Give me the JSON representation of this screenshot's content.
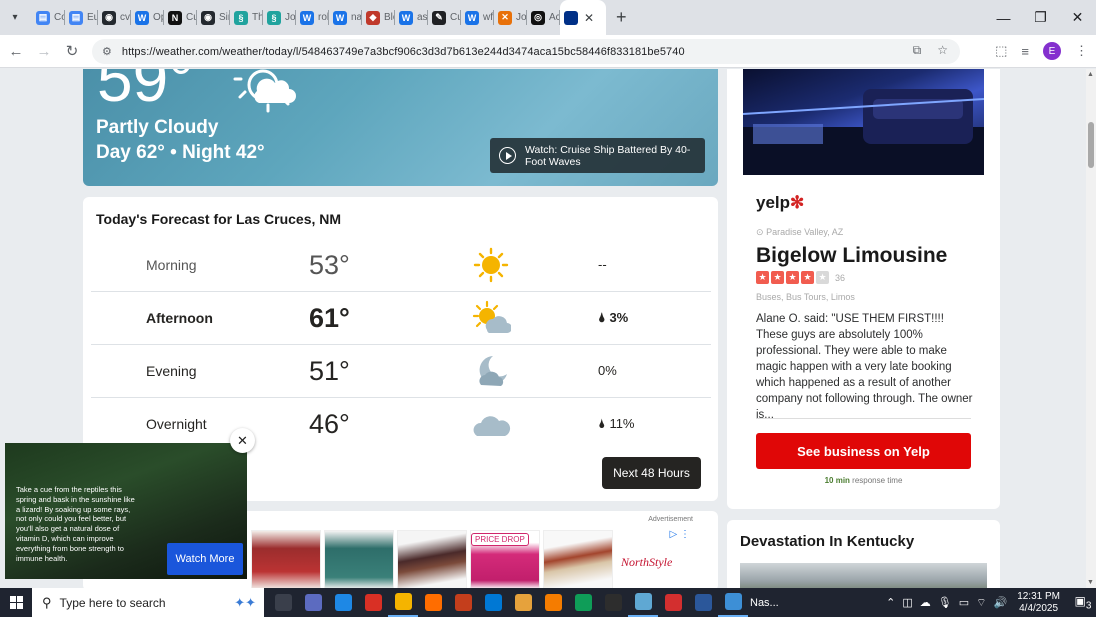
{
  "browser": {
    "tabs": [
      {
        "title": "Cov",
        "color": "#4285f4",
        "glyph": "▤"
      },
      {
        "title": "Eug",
        "color": "#4285f4",
        "glyph": "▤"
      },
      {
        "title": "cvn",
        "color": "#24292f",
        "glyph": "◉"
      },
      {
        "title": "Op",
        "color": "#1a73e8",
        "glyph": "W"
      },
      {
        "title": "Cus",
        "color": "#111111",
        "glyph": "N"
      },
      {
        "title": "Sin",
        "color": "#24292f",
        "glyph": "◉"
      },
      {
        "title": "Tha",
        "color": "#20a39e",
        "glyph": "§"
      },
      {
        "title": "Job",
        "color": "#20a39e",
        "glyph": "§"
      },
      {
        "title": "rob",
        "color": "#1a73e8",
        "glyph": "W"
      },
      {
        "title": "nat",
        "color": "#1a73e8",
        "glyph": "W"
      },
      {
        "title": "Blo",
        "color": "#c0392b",
        "glyph": "◆"
      },
      {
        "title": "ass",
        "color": "#1a73e8",
        "glyph": "W"
      },
      {
        "title": "Cur",
        "color": "#202124",
        "glyph": "✎"
      },
      {
        "title": "wf",
        "color": "#1a73e8",
        "glyph": "W"
      },
      {
        "title": "Job",
        "color": "#e8710a",
        "glyph": "✕"
      },
      {
        "title": "Act",
        "color": "#111111",
        "glyph": "◎"
      }
    ],
    "active_tab": {
      "color": "#003087",
      "close": "✕"
    },
    "new_tab": "+",
    "window_controls": {
      "minimize": "—",
      "maximize": "❐",
      "close": "✕"
    },
    "url": "https://weather.com/weather/today/l/548463749e7a3bcf906c3d3d7b613e244d3474aca15bc58446f833181be5740"
  },
  "hero": {
    "temperature": "59°",
    "phrase": "Partly Cloudy",
    "day_night": "Day 62° • Night 42°",
    "video_title": "Watch: Cruise Ship Battered By 40-Foot Waves"
  },
  "forecast": {
    "title": "Today's Forecast for Las Cruces, NM",
    "rows": [
      {
        "period": "Morning",
        "temp": "53°",
        "icon": "sunny",
        "precip": "--"
      },
      {
        "period": "Afternoon",
        "temp": "61°",
        "icon": "partly-cloudy-day",
        "precip": "3%"
      },
      {
        "period": "Evening",
        "temp": "51°",
        "icon": "mostly-cloudy-night",
        "precip": "0%"
      },
      {
        "period": "Overnight",
        "temp": "46°",
        "icon": "cloudy",
        "precip": "11%"
      }
    ],
    "next_button": "Next 48 Hours"
  },
  "video_ad": {
    "text": "Take a cue from the reptiles this spring and bask in the sunshine like a lizard! By soaking up some rays, not only could you feel better, but you'll also get a natural dose of vitamin D, which can improve everything from bone strength to immune health.",
    "button": "Watch More",
    "close": "✕"
  },
  "ad_strip": {
    "label": "Advertisement",
    "price_drop": "PRICE DROP",
    "brand": "NorthStyle"
  },
  "yelp": {
    "logo": "yelp",
    "location": "Paradise Valley, AZ",
    "business": "Bigelow Limousine",
    "rating": 4,
    "rating_count": "36",
    "categories": "Buses, Bus Tours, Limos",
    "review": "Alane O. said: \"USE THEM FIRST!!!! These guys are absolutely 100% professional. They were able to make magic happen with a very late booking which happened as a result of another company not following through. The owner is...",
    "button": "See business on Yelp",
    "response_strong": "10 min",
    "response_rest": "response time"
  },
  "news": {
    "title": "Devastation In Kentucky"
  },
  "taskbar": {
    "search_placeholder": "Type here to search",
    "task_label": "Nas...",
    "time": "12:31 PM",
    "date": "4/4/2025",
    "notifications": "3"
  }
}
